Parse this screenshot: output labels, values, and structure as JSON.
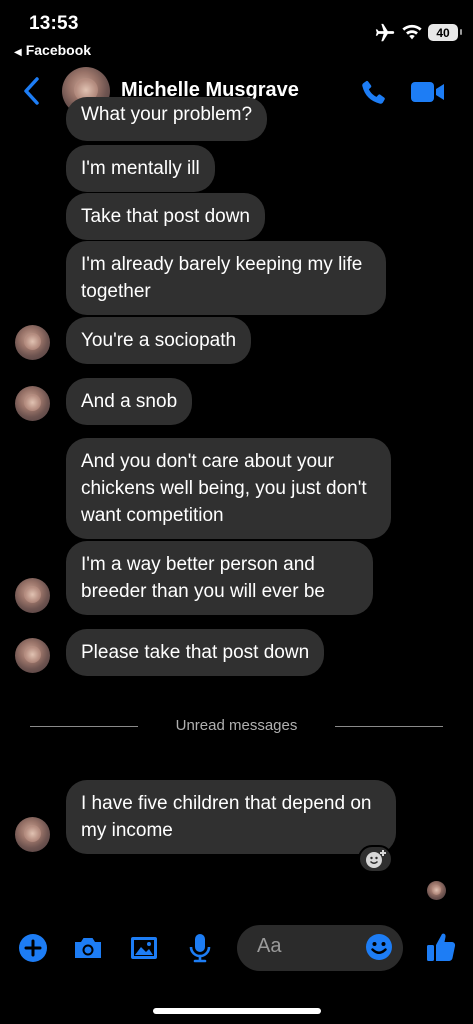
{
  "status_bar": {
    "time": "13:53",
    "back_app": "Facebook",
    "battery": "40"
  },
  "header": {
    "contact_name": "Michelle Musgrave",
    "accent_color": "#1d7df5"
  },
  "messages": [
    {
      "text": "What your problem?"
    },
    {
      "text": "I'm mentally ill"
    },
    {
      "text": "Take that post down"
    },
    {
      "text": "I'm already barely keeping my life together"
    },
    {
      "text": "You're a sociopath"
    },
    {
      "text": "And a snob"
    },
    {
      "text": "And you don't care about your chickens well being, you just don't want competition"
    },
    {
      "text": "I'm a way better person and breeder than you will ever be"
    },
    {
      "text": "Please take that post down"
    },
    {
      "text": "I have five children that depend on my income"
    }
  ],
  "divider": {
    "label": "Unread messages"
  },
  "composer": {
    "placeholder": "Aa",
    "icons": [
      "plus-icon",
      "camera-icon",
      "gallery-icon",
      "microphone-icon",
      "emoji-icon",
      "thumbs-up-icon"
    ]
  }
}
